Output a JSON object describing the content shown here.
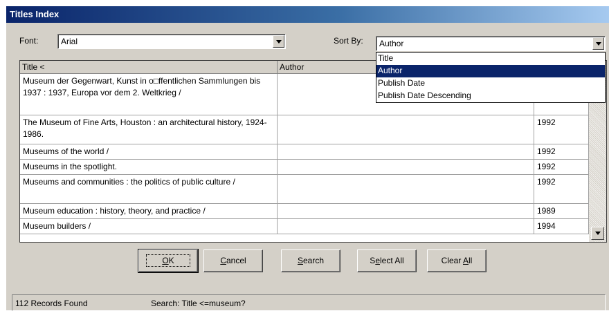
{
  "window": {
    "title": "Titles Index"
  },
  "font_field": {
    "label": "Font:",
    "value": "Arial"
  },
  "sort_field": {
    "label": "Sort By:",
    "value": "Author",
    "options": [
      "Title",
      "Author",
      "Publish Date",
      "Publish Date Descending"
    ],
    "highlighted": "Author"
  },
  "table": {
    "columns": [
      "Title <",
      "Author",
      ""
    ],
    "rows": [
      {
        "title": "Museum der Gegenwart, Kunst in o□ffentlichen Sammlungen bis 1937 : 1937, Europa vor dem 2. Weltkrieg /",
        "author": "",
        "year": ""
      },
      {
        "title": "The Museum of Fine Arts, Houston : an architectural history, 1924-1986.",
        "author": "",
        "year": "1992"
      },
      {
        "title": "Museums of the world /",
        "author": "",
        "year": "1992"
      },
      {
        "title": "Museums in the spotlight.",
        "author": "",
        "year": "1992"
      },
      {
        "title": "Museums and communities : the politics of public culture /",
        "author": "",
        "year": "1992"
      },
      {
        "title": "Museum education : history, theory, and practice /",
        "author": "",
        "year": "1989"
      },
      {
        "title": "Museum builders /",
        "author": "",
        "year": "1994"
      }
    ]
  },
  "buttons": {
    "ok": {
      "prefix": "",
      "mnemonic": "O",
      "suffix": "K"
    },
    "cancel": {
      "prefix": "",
      "mnemonic": "C",
      "suffix": "ancel"
    },
    "search": {
      "prefix": "",
      "mnemonic": "S",
      "suffix": "earch"
    },
    "select_all": {
      "prefix": "S",
      "mnemonic": "e",
      "suffix": "lect All"
    },
    "clear_all": {
      "prefix": "Clear ",
      "mnemonic": "A",
      "suffix": "ll"
    }
  },
  "status": {
    "records": "112 Records Found",
    "search": "Search: Title <=museum?"
  }
}
